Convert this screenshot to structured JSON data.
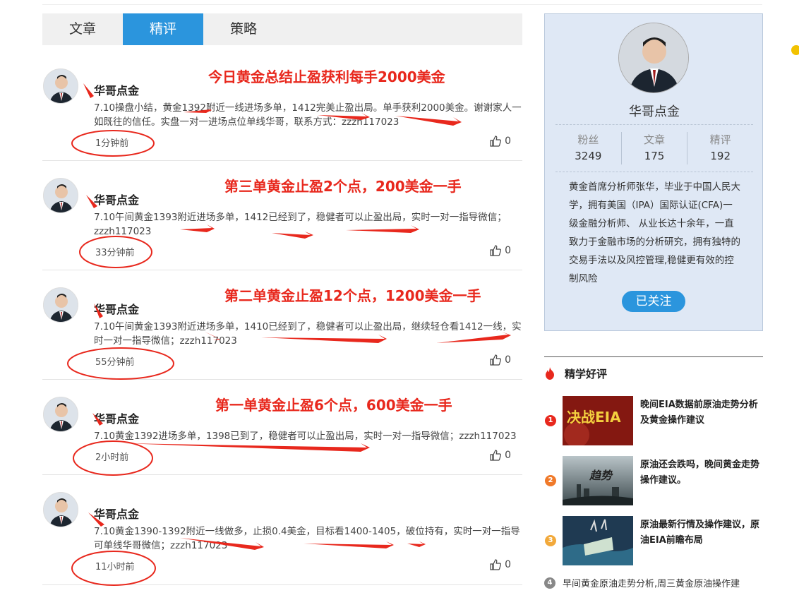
{
  "tabs": [
    {
      "label": "文章",
      "active": false
    },
    {
      "label": "精评",
      "active": true
    },
    {
      "label": "策略",
      "active": false
    }
  ],
  "posts": [
    {
      "author": "华哥点金",
      "content": "7.10操盘小结，黄金1392附近一线进场多单，1412完美止盈出局。单手获利2000美金。谢谢家人一如既往的信任。实盘一对一进场点位单线华哥，联系方式：zzzh117023",
      "time": "1分钟前",
      "likes": "0",
      "headline": "今日黄金总结止盈获利每手2000美金"
    },
    {
      "author": "华哥点金",
      "content": "7.10午间黄金1393附近进场多单，1412已经到了，稳健者可以止盈出局，实时一对一指导微信；zzzh117023",
      "time": "33分钟前",
      "likes": "0",
      "headline": "第三单黄金止盈2个点，200美金一手"
    },
    {
      "author": "华哥点金",
      "content": "7.10午间黄金1393附近进场多单，1410已经到了，稳健者可以止盈出局，继续轻仓看1412一线，实时一对一指导微信；zzzh117023",
      "time": "55分钟前",
      "likes": "0",
      "headline": "第二单黄金止盈12个点，1200美金一手"
    },
    {
      "author": "华哥点金",
      "content": "7.10黄金1392进场多单，1398已到了，稳健者可以止盈出局，实时一对一指导微信；zzzh117023",
      "time": "2小时前",
      "likes": "0",
      "headline": "第一单黄金止盈6个点，600美金一手"
    },
    {
      "author": "华哥点金",
      "content": "7.10黄金1390-1392附近一线做多，止损0.4美金，目标看1400-1405，破位持有，实时一对一指导可单线华哥微信；zzzh117023",
      "time": "11小时前",
      "likes": "0",
      "headline": ""
    }
  ],
  "profile": {
    "name": "华哥点金",
    "stats": [
      {
        "label": "粉丝",
        "value": "3249"
      },
      {
        "label": "文章",
        "value": "175"
      },
      {
        "label": "精评",
        "value": "192"
      }
    ],
    "bio": "黄金首席分析师张华，毕业于中国人民大学，拥有美国（IPA）国际认证(CFA)一级金融分析师、 从业长达十余年，一直致力于金融市场的分析研究，拥有独特的交易手法以及风控管理,稳健更有效的控制风险",
    "follow_label": "已关注"
  },
  "recommend": {
    "title": "精学好评",
    "items": [
      {
        "num": "1",
        "text": "晚间EIA数据前原油走势分析及黄金操作建议",
        "color": "#e8281d",
        "thumb_text": "决战EIA"
      },
      {
        "num": "2",
        "text": "原油还会跌吗，晚间黄金走势操作建议。",
        "color": "#f07a2a",
        "thumb_text": "趋势"
      },
      {
        "num": "3",
        "text": "原油最新行情及操作建议，原油EIA前瞻布局",
        "color": "#f2a93b",
        "thumb_text": ""
      }
    ],
    "last": {
      "num": "4",
      "text": "早间黄金原油走势分析,周三黄金原油操作建"
    }
  },
  "colors": {
    "accent": "#2b95dd",
    "annotation": "#e8281d"
  }
}
